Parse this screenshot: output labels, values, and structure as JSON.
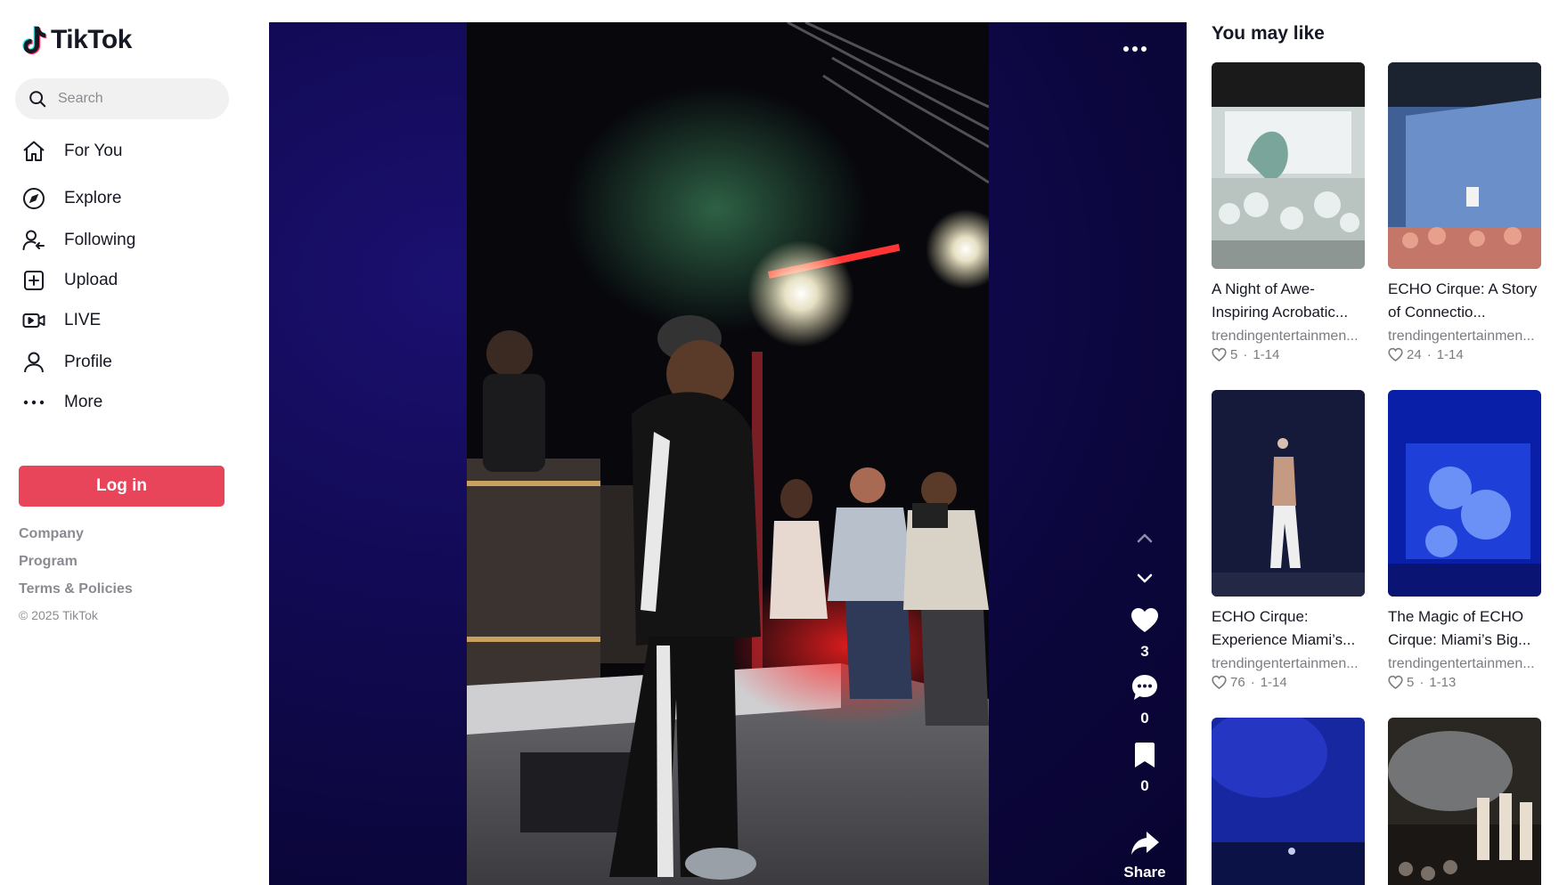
{
  "app": {
    "name": "TikTok"
  },
  "search": {
    "placeholder": "Search"
  },
  "nav": [
    {
      "label": "For You",
      "icon": "home-icon"
    },
    {
      "label": "Explore",
      "icon": "compass-icon"
    },
    {
      "label": "Following",
      "icon": "following-icon"
    },
    {
      "label": "Upload",
      "icon": "upload-icon"
    },
    {
      "label": "LIVE",
      "icon": "live-camera-icon"
    },
    {
      "label": "Profile",
      "icon": "profile-icon"
    },
    {
      "label": "More",
      "icon": "more-dots-icon"
    }
  ],
  "login": {
    "label": "Log in"
  },
  "footer": {
    "links": [
      "Company",
      "Program",
      "Terms & Policies"
    ],
    "copyright": "© 2025 TikTok"
  },
  "video": {
    "likes": "3",
    "comments": "0",
    "saves": "0",
    "share_label": "Share"
  },
  "recommendations": {
    "title": "You may like",
    "items": [
      {
        "title": "A Night of Awe-Inspiring Acrobatic...",
        "author": "trendingentertainmen...",
        "likes": "5",
        "date": "1-14"
      },
      {
        "title": "ECHO Cirque: A Story of Connectio...",
        "author": "trendingentertainmen...",
        "likes": "24",
        "date": "1-14"
      },
      {
        "title": "ECHO Cirque: Experience Miami’s...",
        "author": "trendingentertainmen...",
        "likes": "76",
        "date": "1-14"
      },
      {
        "title": "The Magic of ECHO Cirque: Miami’s Big...",
        "author": "trendingentertainmen...",
        "likes": "5",
        "date": "1-13"
      },
      {
        "title": "",
        "author": "",
        "likes": "",
        "date": ""
      },
      {
        "title": "",
        "author": "",
        "likes": "",
        "date": ""
      }
    ]
  },
  "colors": {
    "brand_red": "#e8445a",
    "text": "#161823",
    "muted": "#8a8b91"
  }
}
